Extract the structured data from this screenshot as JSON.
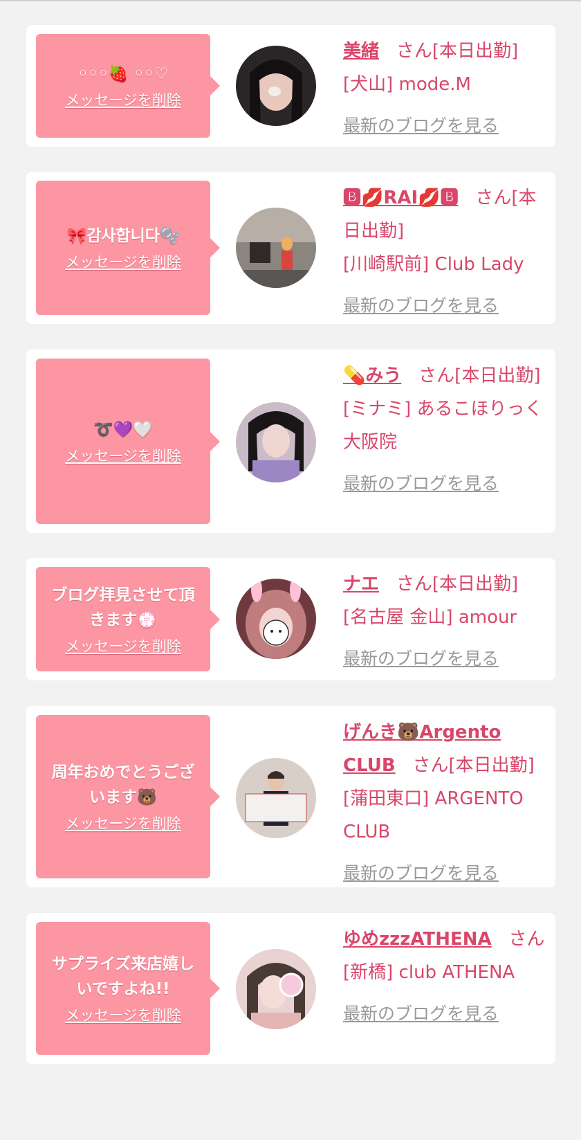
{
  "entries": [
    {
      "message": "◦◦◦🍓 ◦◦♡",
      "delete_label": "メッセージを削除",
      "name": "美緒",
      "suffix": "さん[本日出勤]",
      "shop": "[犬山] mode.M",
      "blog_label": "最新のブログを見る",
      "avatar_icon": "avatar-photo-1"
    },
    {
      "message": "🎀감사합니다🫧",
      "delete_label": "メッセージを削除",
      "name": "🅱💋RAI💋🅱",
      "suffix": "さん[本日出勤]",
      "shop": "[川崎駅前] Club Lady",
      "blog_label": "最新のブログを見る",
      "avatar_icon": "avatar-photo-2"
    },
    {
      "message": "➰💜🤍",
      "delete_label": "メッセージを削除",
      "name": "💊みう",
      "suffix": "さん[本日出勤]",
      "shop": "[ミナミ] あるこほりっく 大阪院",
      "blog_label": "最新のブログを見る",
      "avatar_icon": "avatar-photo-3"
    },
    {
      "message": "ブログ拝見させて頂きます💮",
      "delete_label": "メッセージを削除",
      "name": "ナエ",
      "suffix": "さん[本日出勤]",
      "shop": "[名古屋 金山] amour",
      "blog_label": "最新のブログを見る",
      "avatar_icon": "avatar-photo-4"
    },
    {
      "message": "周年おめでとうございます🐻",
      "delete_label": "メッセージを削除",
      "name": "げんき🐻Argento CLUB",
      "suffix": "さん[本日出勤]",
      "shop": "[蒲田東口] ARGENTO CLUB",
      "blog_label": "最新のブログを見る",
      "avatar_icon": "avatar-photo-5"
    },
    {
      "message": "サプライズ来店嬉しいですよね!!",
      "delete_label": "メッセージを削除",
      "name": "ゆめzzzATHENA",
      "suffix": "さん",
      "shop": "[新橋] club ATHENA",
      "blog_label": "最新のブログを見る",
      "avatar_icon": "avatar-photo-6"
    }
  ],
  "colors": {
    "background": "#f2f2f2",
    "bubble": "#fd96a3",
    "accent": "#d9466a",
    "link_gray": "#999999"
  }
}
